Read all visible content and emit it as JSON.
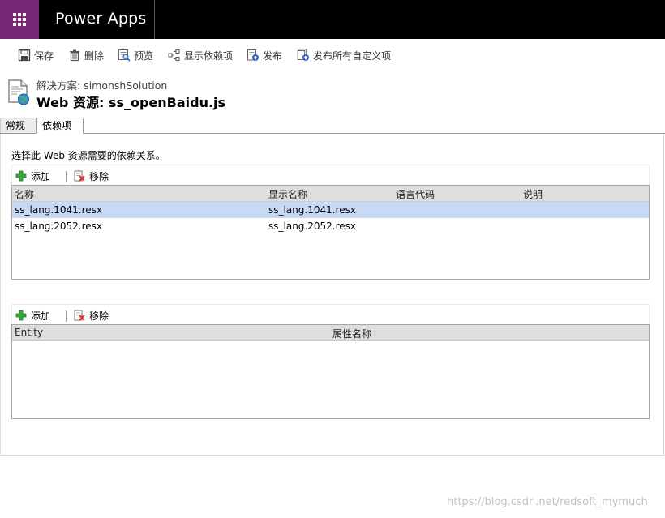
{
  "app": {
    "title": "Power Apps"
  },
  "toolbar": {
    "save": "保存",
    "delete": "删除",
    "preview": "预览",
    "show_dependencies": "显示依赖项",
    "publish": "发布",
    "publish_all": "发布所有自定义项"
  },
  "header": {
    "solution": "解决方案: simonshSolution",
    "title": "Web 资源: ss_openBaidu.js"
  },
  "tabs": [
    {
      "label": "常规"
    },
    {
      "label": "依赖项"
    }
  ],
  "instruction": "选择此 Web 资源需要的依赖关系。",
  "dependencies": {
    "add": "添加",
    "remove": "移除",
    "columns": [
      "名称",
      "显示名称",
      "语言代码",
      "说明"
    ],
    "rows": [
      {
        "name": "ss_lang.1041.resx",
        "display_name": "ss_lang.1041.resx",
        "language_code": "",
        "description": ""
      },
      {
        "name": "ss_lang.2052.resx",
        "display_name": "ss_lang.2052.resx",
        "language_code": "",
        "description": ""
      }
    ]
  },
  "attributes": {
    "add": "添加",
    "remove": "移除",
    "columns": [
      "Entity",
      "属性名称"
    ]
  },
  "watermark": "https://blog.csdn.net/redsoft_mymuch",
  "colors": {
    "waffle_bg": "#742774",
    "topbar_bg": "#000000",
    "selected_row": "#c8d9f5",
    "grid_header": "#dedede",
    "add_green": "#2e9e2e"
  }
}
